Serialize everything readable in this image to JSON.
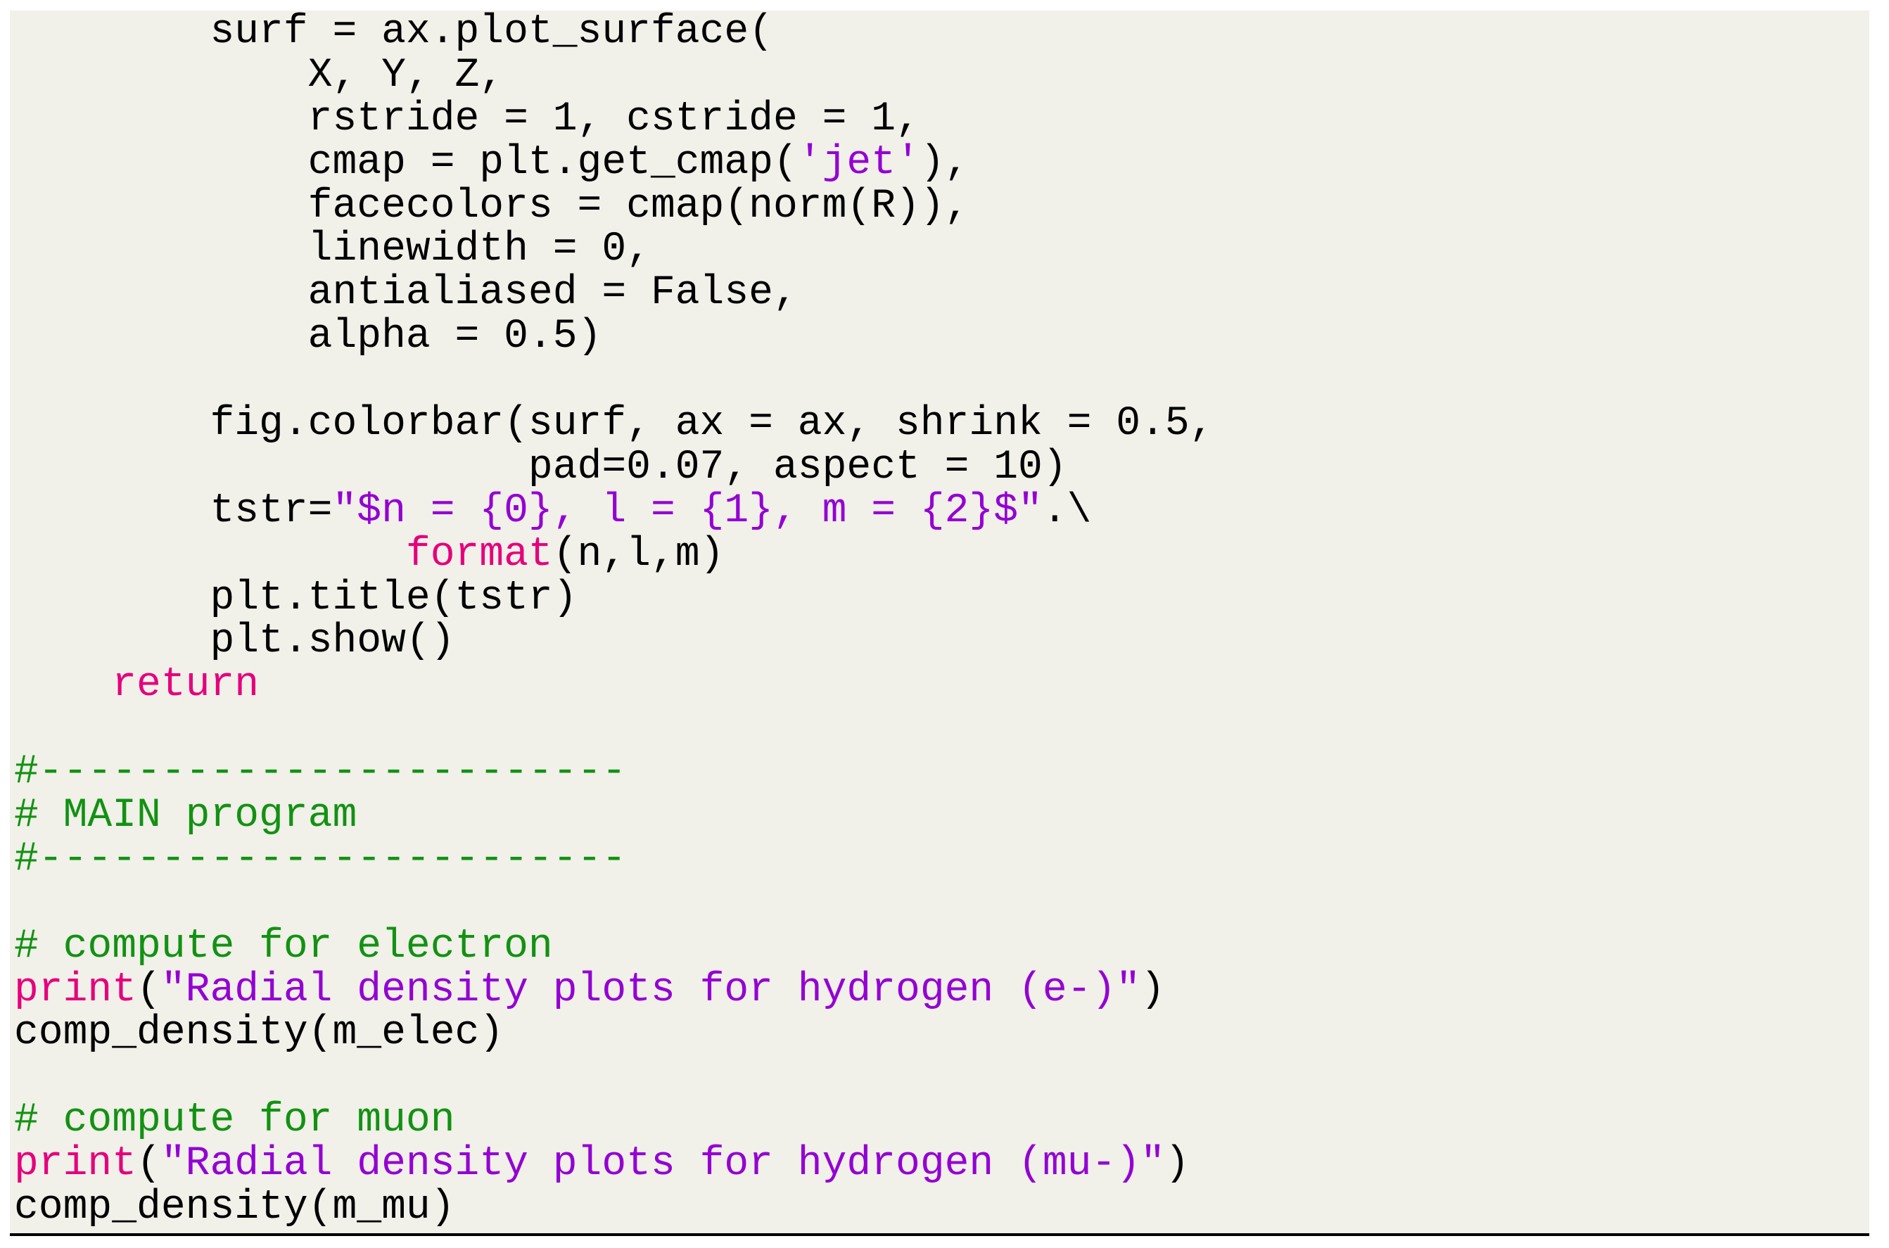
{
  "document": {
    "type": "code-listing",
    "language": "python",
    "colors": {
      "background": "#f1f0e9",
      "text": "#000000",
      "keyword": "#e5007d",
      "string": "#9400d3",
      "comment": "#129212",
      "rule": "#000000"
    },
    "lines": [
      [
        {
          "t": "txt",
          "v": "        surf = ax.plot_surface("
        }
      ],
      [
        {
          "t": "txt",
          "v": "            X, Y, Z,"
        }
      ],
      [
        {
          "t": "txt",
          "v": "            rstride = 1, cstride = 1,"
        }
      ],
      [
        {
          "t": "txt",
          "v": "            cmap = plt.get_cmap("
        },
        {
          "t": "str",
          "v": "'jet'"
        },
        {
          "t": "txt",
          "v": "),"
        }
      ],
      [
        {
          "t": "txt",
          "v": "            facecolors = cmap(norm(R)),"
        }
      ],
      [
        {
          "t": "txt",
          "v": "            linewidth = 0,"
        }
      ],
      [
        {
          "t": "txt",
          "v": "            antialiased = False,"
        }
      ],
      [
        {
          "t": "txt",
          "v": "            alpha = 0.5)"
        }
      ],
      [
        {
          "t": "txt",
          "v": ""
        }
      ],
      [
        {
          "t": "txt",
          "v": "        fig.colorbar(surf, ax = ax, shrink = 0.5,"
        }
      ],
      [
        {
          "t": "txt",
          "v": "                     pad=0.07, aspect = 10)"
        }
      ],
      [
        {
          "t": "txt",
          "v": "        tstr="
        },
        {
          "t": "str",
          "v": "\"$n = {0}, l = {1}, m = {2}$\""
        },
        {
          "t": "txt",
          "v": ".\\"
        }
      ],
      [
        {
          "t": "txt",
          "v": "                "
        },
        {
          "t": "kw",
          "v": "format"
        },
        {
          "t": "txt",
          "v": "(n,l,m)"
        }
      ],
      [
        {
          "t": "txt",
          "v": "        plt.title(tstr)"
        }
      ],
      [
        {
          "t": "txt",
          "v": "        plt.show()"
        }
      ],
      [
        {
          "t": "txt",
          "v": "    "
        },
        {
          "t": "kw",
          "v": "return"
        }
      ],
      [
        {
          "t": "txt",
          "v": ""
        }
      ],
      [
        {
          "t": "cmt",
          "v": "#------------------------"
        }
      ],
      [
        {
          "t": "cmt",
          "v": "# MAIN program"
        }
      ],
      [
        {
          "t": "cmt",
          "v": "#------------------------"
        }
      ],
      [
        {
          "t": "txt",
          "v": ""
        }
      ],
      [
        {
          "t": "cmt",
          "v": "# compute for electron"
        }
      ],
      [
        {
          "t": "kw",
          "v": "print"
        },
        {
          "t": "txt",
          "v": "("
        },
        {
          "t": "str",
          "v": "\"Radial density plots for hydrogen (e-)\""
        },
        {
          "t": "txt",
          "v": ")"
        }
      ],
      [
        {
          "t": "txt",
          "v": "comp_density(m_elec)"
        }
      ],
      [
        {
          "t": "txt",
          "v": ""
        }
      ],
      [
        {
          "t": "cmt",
          "v": "# compute for muon"
        }
      ],
      [
        {
          "t": "kw",
          "v": "print"
        },
        {
          "t": "txt",
          "v": "("
        },
        {
          "t": "str",
          "v": "\"Radial density plots for hydrogen (mu-)\""
        },
        {
          "t": "txt",
          "v": ")"
        }
      ],
      [
        {
          "t": "txt",
          "v": "comp_density(m_mu)"
        }
      ]
    ]
  }
}
